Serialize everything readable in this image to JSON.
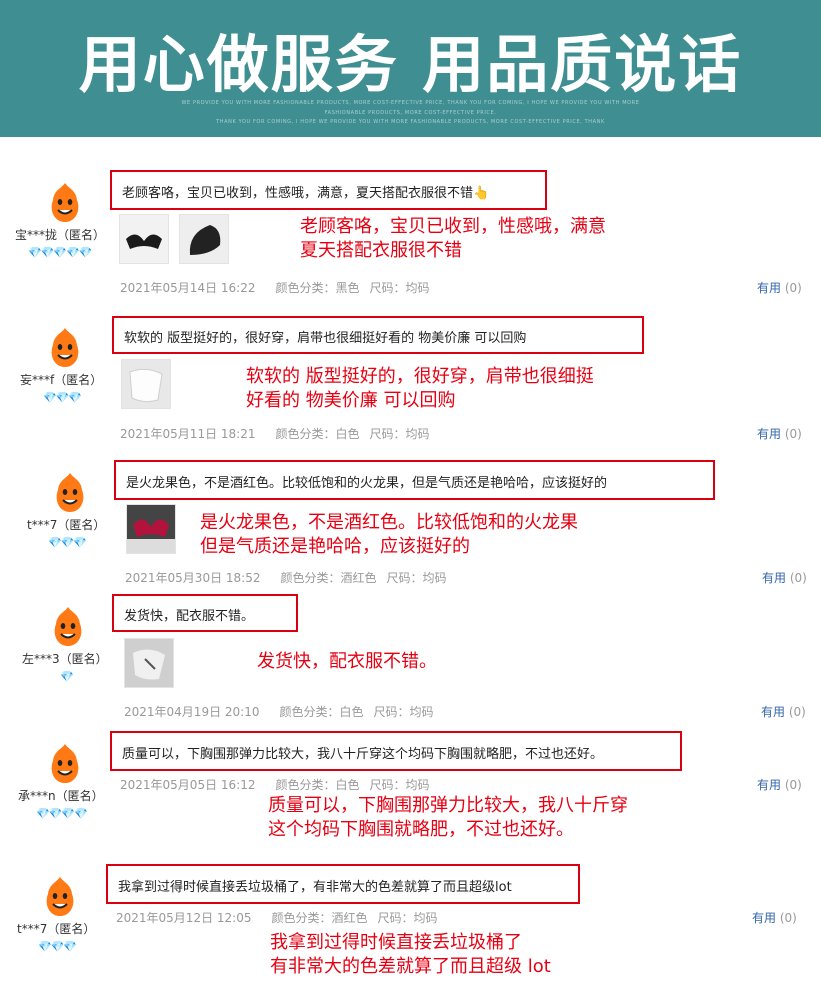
{
  "banner": {
    "title": "用心做服务 用品质说话",
    "sub_line1": "WE PROVIDE YOU WITH MORE FASHIONABLE PRODUCTS, MORE COST-EFFECTIVE PRICE, THANK YOU FOR COMING, I HOPE WE PROVIDE YOU WITH MORE",
    "sub_line2": "FASHIONABLE PRODUCTS, MORE COST-EFFECTIVE PRICE.",
    "sub_line3": "THANK YOU FOR COMING, I HOPE WE PROVIDE YOU WITH MORE FASHIONABLE PRODUCTS, MORE COST-EFFECTIVE PRICE, THANK",
    "color": "#3f8f92"
  },
  "colors": {
    "highlight": "#d9000f",
    "note_text": "#e60012",
    "gem": "#2aa7e0",
    "useful_link": "#3366aa"
  },
  "reviews": [
    {
      "user": "宝***拢（匿名）",
      "gems": "💎💎💎💎💎",
      "comment": "老顾客咯，宝贝已收到，性感哦，满意，夏天搭配衣服很不错👆",
      "note_line1": "老顾客咯，宝贝已收到，性感哦，满意",
      "note_line2": "夏天搭配衣服很不错",
      "date": "2021年05月14日 16:22",
      "color": "颜色分类：黑色",
      "size": "尺码：均码",
      "useful_label": "有用",
      "useful_count": "(0)"
    },
    {
      "user": "妄***f（匿名）",
      "gems": "💎💎💎",
      "comment": "软软的 版型挺好的，很好穿，肩带也很细挺好看的 物美价廉 可以回购",
      "note_line1": "软软的 版型挺好的，很好穿，肩带也很细挺",
      "note_line2": "好看的 物美价廉 可以回购",
      "date": "2021年05月11日 18:21",
      "color": "颜色分类：白色",
      "size": "尺码：均码",
      "useful_label": "有用",
      "useful_count": "(0)"
    },
    {
      "user": "t***7（匿名）",
      "gems": "💎💎💎",
      "comment": "是火龙果色，不是酒红色。比较低饱和的火龙果，但是气质还是艳哈哈，应该挺好的",
      "note_line1": "是火龙果色，不是酒红色。比较低饱和的火龙果",
      "note_line2": "但是气质还是艳哈哈，应该挺好的",
      "date": "2021年05月30日 18:52",
      "color": "颜色分类：酒红色",
      "size": "尺码：均码",
      "useful_label": "有用",
      "useful_count": "(0)"
    },
    {
      "user": "左***3（匿名）",
      "gems": "💎",
      "comment": "发货快，配衣服不错。",
      "note_line1": "发货快，配衣服不错。",
      "date": "2021年04月19日 20:10",
      "color": "颜色分类：白色",
      "size": "尺码：均码",
      "useful_label": "有用",
      "useful_count": "(0)"
    },
    {
      "user": "承***n（匿名）",
      "gems": "💎💎💎💎",
      "comment": "质量可以，下胸围那弹力比较大，我八十斤穿这个均码下胸围就略肥，不过也还好。",
      "note_line1": "质量可以，下胸围那弹力比较大，我八十斤穿",
      "note_line2": "这个均码下胸围就略肥，不过也还好。",
      "date": "2021年05月05日 16:12",
      "color": "颜色分类：白色",
      "size": "尺码：均码",
      "useful_label": "有用",
      "useful_count": "(0)"
    },
    {
      "user": "t***7（匿名）",
      "gems": "💎💎💎",
      "comment": "我拿到过得时候直接丢垃圾桶了，有非常大的色差就算了而且超级lot",
      "note_line1": "我拿到过得时候直接丢垃圾桶了",
      "note_line2": "有非常大的色差就算了而且超级 lot",
      "date": "2021年05月12日 12:05",
      "color": "颜色分类：酒红色",
      "size": "尺码：均码",
      "useful_label": "有用",
      "useful_count": "(0)"
    }
  ]
}
